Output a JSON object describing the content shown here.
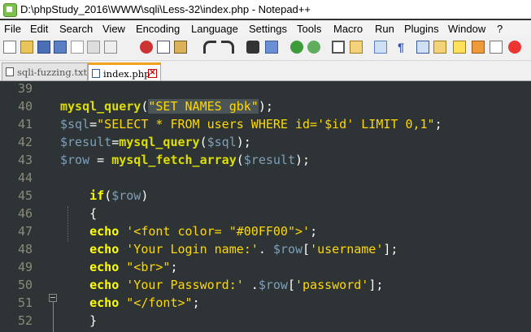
{
  "window": {
    "title": "D:\\phpStudy_2016\\WWW\\sqli\\Less-32\\index.php - Notepad++"
  },
  "menu": [
    "File",
    "Edit",
    "Search",
    "View",
    "Encoding",
    "Language",
    "Settings",
    "Tools",
    "Macro",
    "Run",
    "Plugins",
    "Window",
    "?"
  ],
  "tabs": [
    {
      "label": "sqli-fuzzing.txt",
      "active": false
    },
    {
      "label": "index.php",
      "active": true
    }
  ],
  "colors": {
    "background": "#2e3436",
    "function": "#dede00",
    "variable": "#7f9fb8",
    "string": "#ffd800"
  },
  "lines": [
    {
      "n": "39",
      "tokens": []
    },
    {
      "n": "40",
      "tokens": [
        {
          "t": "mysql_query",
          "c": "fn"
        },
        {
          "t": "(",
          "c": "op"
        },
        {
          "t": "\"SET NAMES gbk\"",
          "c": "str-hl"
        },
        {
          "t": ");",
          "c": "op"
        }
      ]
    },
    {
      "n": "41",
      "tokens": [
        {
          "t": "$sql",
          "c": "var"
        },
        {
          "t": "=",
          "c": "op"
        },
        {
          "t": "\"SELECT * FROM users WHERE id='$id' LIMIT 0,1\"",
          "c": "str"
        },
        {
          "t": ";",
          "c": "op"
        }
      ]
    },
    {
      "n": "42",
      "tokens": [
        {
          "t": "$result",
          "c": "var"
        },
        {
          "t": "=",
          "c": "op"
        },
        {
          "t": "mysql_query",
          "c": "fn"
        },
        {
          "t": "(",
          "c": "op"
        },
        {
          "t": "$sql",
          "c": "var"
        },
        {
          "t": ");",
          "c": "op"
        }
      ]
    },
    {
      "n": "43",
      "tokens": [
        {
          "t": "$row",
          "c": "var"
        },
        {
          "t": " = ",
          "c": "op"
        },
        {
          "t": "mysql_fetch_array",
          "c": "fn"
        },
        {
          "t": "(",
          "c": "op"
        },
        {
          "t": "$result",
          "c": "var"
        },
        {
          "t": ");",
          "c": "op"
        }
      ]
    },
    {
      "n": "44",
      "tokens": []
    },
    {
      "n": "45",
      "tokens": [
        {
          "t": "    ",
          "c": "op"
        },
        {
          "t": "if",
          "c": "kw"
        },
        {
          "t": "(",
          "c": "op"
        },
        {
          "t": "$row",
          "c": "var"
        },
        {
          "t": ")",
          "c": "op"
        }
      ]
    },
    {
      "n": "46",
      "tokens": [
        {
          "t": "    {",
          "c": "op"
        }
      ]
    },
    {
      "n": "47",
      "tokens": [
        {
          "t": "    ",
          "c": "op"
        },
        {
          "t": "echo",
          "c": "kw"
        },
        {
          "t": " ",
          "c": "op"
        },
        {
          "t": "'<font color= \"#00FF00\">'",
          "c": "str"
        },
        {
          "t": ";",
          "c": "op"
        }
      ]
    },
    {
      "n": "48",
      "tokens": [
        {
          "t": "    ",
          "c": "op"
        },
        {
          "t": "echo",
          "c": "kw"
        },
        {
          "t": " ",
          "c": "op"
        },
        {
          "t": "'Your Login name:'",
          "c": "str"
        },
        {
          "t": ". ",
          "c": "op"
        },
        {
          "t": "$row",
          "c": "var"
        },
        {
          "t": "[",
          "c": "op"
        },
        {
          "t": "'username'",
          "c": "str"
        },
        {
          "t": "];",
          "c": "op"
        }
      ]
    },
    {
      "n": "49",
      "tokens": [
        {
          "t": "    ",
          "c": "op"
        },
        {
          "t": "echo",
          "c": "kw"
        },
        {
          "t": " ",
          "c": "op"
        },
        {
          "t": "\"<br>\"",
          "c": "str"
        },
        {
          "t": ";",
          "c": "op"
        }
      ]
    },
    {
      "n": "50",
      "tokens": [
        {
          "t": "    ",
          "c": "op"
        },
        {
          "t": "echo",
          "c": "kw"
        },
        {
          "t": " ",
          "c": "op"
        },
        {
          "t": "'Your Password:'",
          "c": "str"
        },
        {
          "t": " .",
          "c": "op"
        },
        {
          "t": "$row",
          "c": "var"
        },
        {
          "t": "[",
          "c": "op"
        },
        {
          "t": "'password'",
          "c": "str"
        },
        {
          "t": "];",
          "c": "op"
        }
      ]
    },
    {
      "n": "51",
      "tokens": [
        {
          "t": "    ",
          "c": "op"
        },
        {
          "t": "echo",
          "c": "kw"
        },
        {
          "t": " ",
          "c": "op"
        },
        {
          "t": "\"</font>\"",
          "c": "str"
        },
        {
          "t": ";",
          "c": "op"
        }
      ]
    },
    {
      "n": "52",
      "tokens": [
        {
          "t": "    }",
          "c": "op"
        }
      ]
    }
  ]
}
